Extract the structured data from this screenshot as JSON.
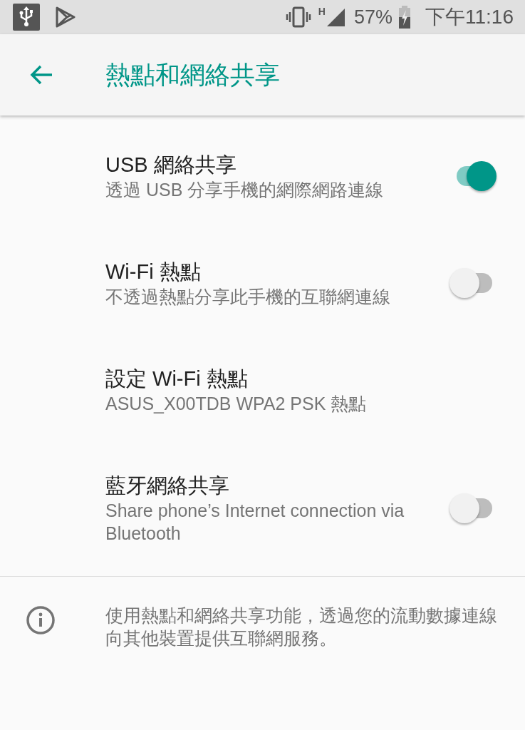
{
  "status_bar": {
    "network_type": "H",
    "battery": "57%",
    "time": "下午11:16"
  },
  "app_bar": {
    "title": "熱點和網絡共享"
  },
  "items": [
    {
      "kind": "switch",
      "title": "USB 網絡共享",
      "summary": "透過 USB 分享手機的網際網路連線",
      "on": true
    },
    {
      "kind": "switch",
      "title": "Wi-Fi 熱點",
      "summary": "不透過熱點分享此手機的互聯網連線",
      "on": false
    },
    {
      "kind": "link",
      "title": "設定 Wi-Fi 熱點",
      "summary": "ASUS_X00TDB WPA2 PSK 熱點"
    },
    {
      "kind": "switch",
      "title": "藍牙網絡共享",
      "summary": "Share phone’s Internet connection via Bluetooth",
      "on": false
    }
  ],
  "footer": {
    "text": "使用熱點和網絡共享功能，透過您的流動數據連線向其他裝置提供互聯網服務。"
  }
}
